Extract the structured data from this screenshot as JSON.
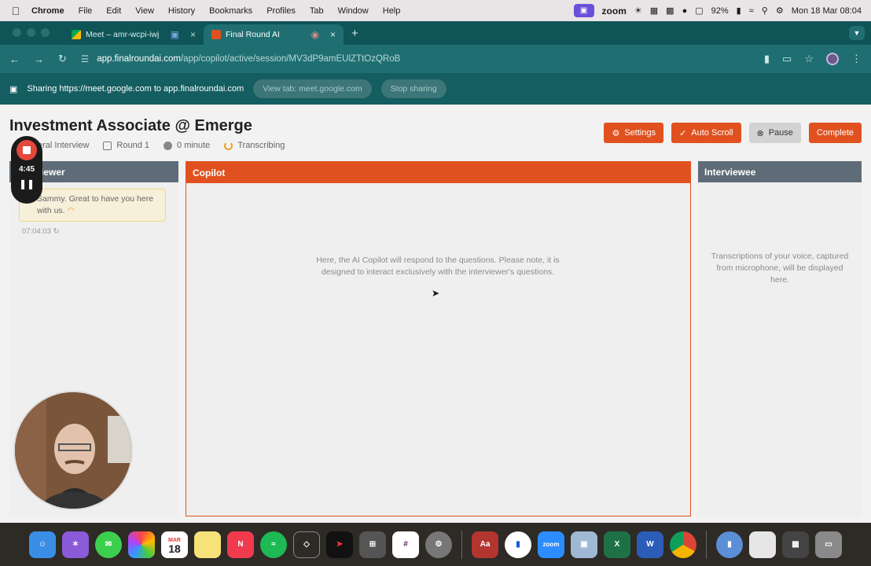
{
  "menubar": {
    "app": "Chrome",
    "items": [
      "File",
      "Edit",
      "View",
      "History",
      "Bookmarks",
      "Profiles",
      "Tab",
      "Window",
      "Help"
    ],
    "zoom": "zoom",
    "battery": "92%",
    "datetime": "Mon 18 Mar 08:04"
  },
  "tabs": [
    {
      "title": "Meet – amr-wcpi-iwj"
    },
    {
      "title": "Final Round AI"
    }
  ],
  "address": {
    "host": "app.finalroundai.com",
    "path": "/app/copilot/active/session/MV3dP9amEUlZTtOzQRoB"
  },
  "sharebar": {
    "text": "Sharing https://meet.google.com to app.finalroundai.com",
    "view_tab": "View tab: meet.google.com",
    "stop": "Stop sharing"
  },
  "page": {
    "title": "Investment Associate @ Emerge",
    "meta": [
      "eral Interview",
      "Round 1",
      "0 minute",
      "Transcribing"
    ],
    "buttons": {
      "settings": "Settings",
      "autoscroll": "Auto Scroll",
      "pause": "Pause",
      "complete": "Complete"
    }
  },
  "recorder": {
    "time": "4:45"
  },
  "panels": {
    "interviewer": {
      "title": "iewer",
      "bubble": "Sammy. Great to have you here with us.",
      "time": "07:04:03"
    },
    "copilot": {
      "title": "Copilot",
      "placeholder": "Here, the AI Copilot will respond to the questions. Please note, it is designed to interact exclusively with the interviewer's questions."
    },
    "interviewee": {
      "title": "Interviewee",
      "placeholder": "Transcriptions of your voice, captured from microphone, will be displayed here."
    }
  },
  "dock": {
    "calendar_month": "MAR",
    "calendar_day": "18",
    "dictionary": "Aa",
    "zoom": "zoom",
    "excel": "X",
    "word": "W"
  },
  "colors": {
    "accent": "#e0511f",
    "browser": "#0f5457",
    "panel_head": "#5f6c78"
  }
}
